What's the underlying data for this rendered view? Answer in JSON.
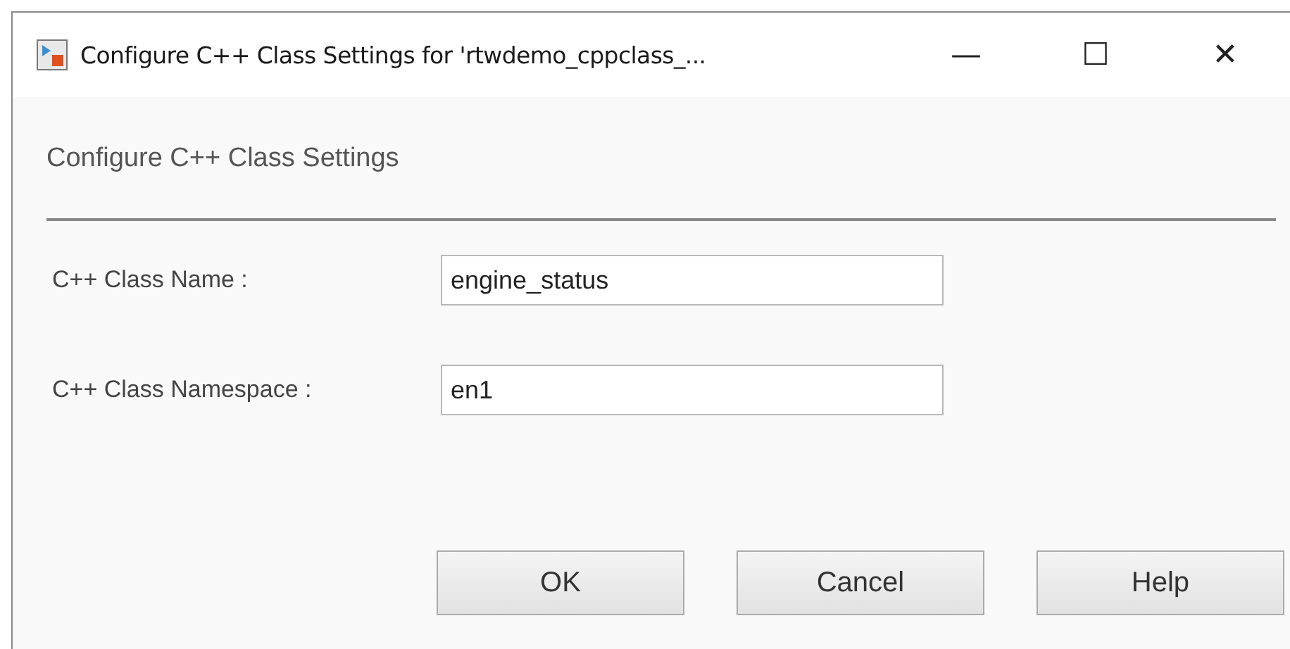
{
  "window": {
    "title": "Configure C++ Class Settings for 'rtwdemo_cppclass_...",
    "controls": [
      "—",
      "☐",
      "✕"
    ]
  },
  "heading": "Configure C++ Class Settings",
  "fields": [
    {
      "label": "C++ Class Name :",
      "value": "engine_status"
    },
    {
      "label": "C++ Class Namespace :",
      "value": "en1"
    }
  ],
  "buttons": [
    "OK",
    "Cancel",
    "Help"
  ]
}
